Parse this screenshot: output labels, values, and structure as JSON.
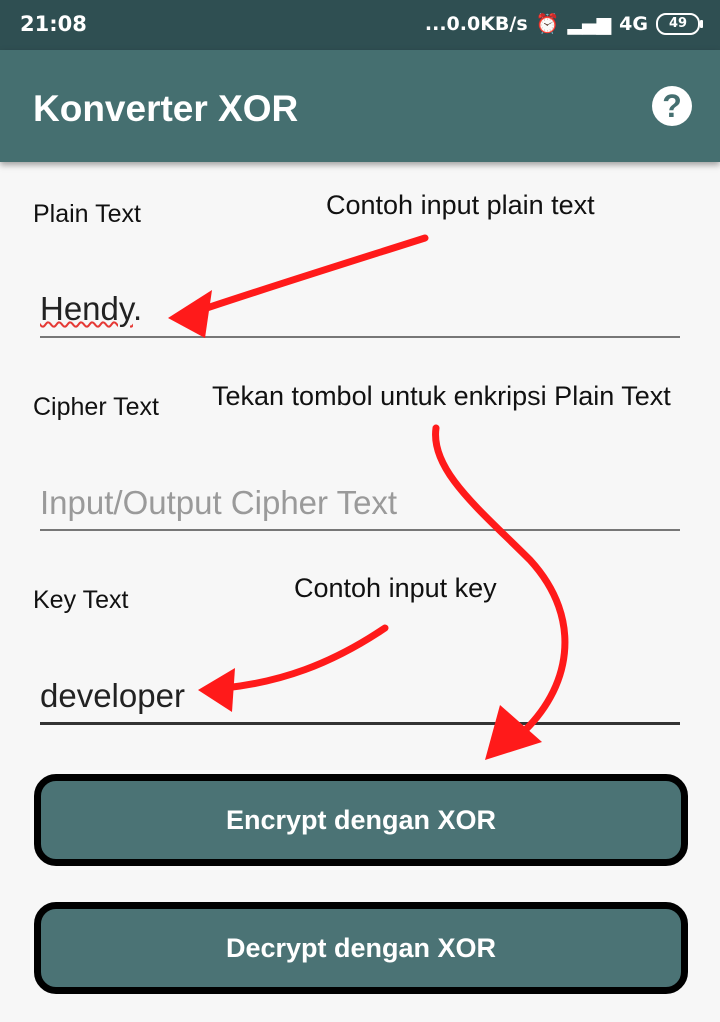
{
  "status_bar": {
    "time": "21:08",
    "network_speed": "...0.0KB/s",
    "network_type": "4G",
    "battery": "49"
  },
  "app_bar": {
    "title": "Konverter XOR",
    "help_icon": "question-circle-icon"
  },
  "form": {
    "plain_text": {
      "label": "Plain Text",
      "value": "Hendy",
      "value_suffix": "."
    },
    "cipher_text": {
      "label": "Cipher Text",
      "placeholder": "Input/Output Cipher Text"
    },
    "key_text": {
      "label": "Key Text",
      "value": "developer"
    }
  },
  "buttons": {
    "encrypt": "Encrypt dengan XOR",
    "decrypt": "Decrypt dengan XOR"
  },
  "annotations": {
    "plain_text_hint": "Contoh input plain text",
    "encrypt_hint": "Tekan tombol untuk enkripsi Plain Text",
    "key_hint": "Contoh input key"
  },
  "colors": {
    "app_bar": "#456f70",
    "status_bar": "#2f4f52",
    "button": "#4b7375",
    "annotation_arrow": "#ff1a1a"
  }
}
